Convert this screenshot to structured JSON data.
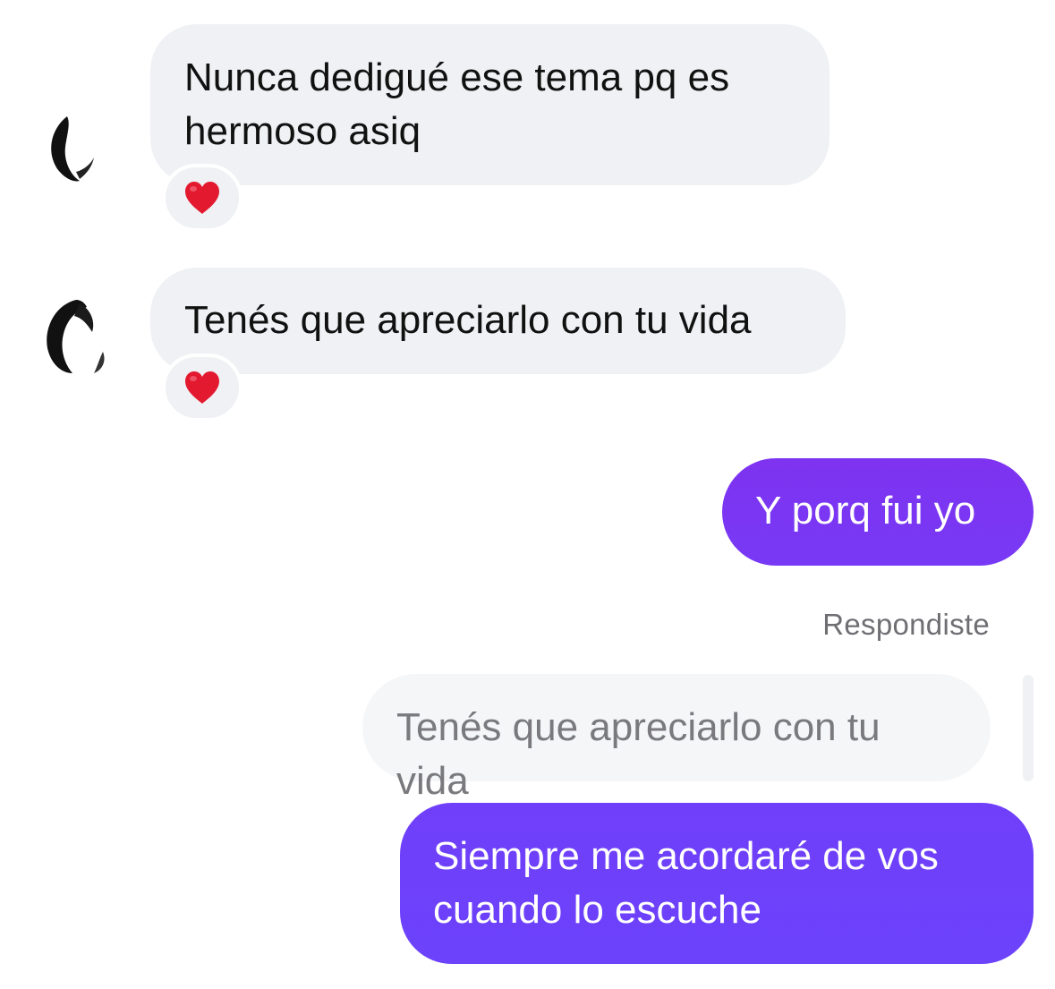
{
  "messages": [
    {
      "direction": "incoming",
      "text_line1": "Nunca dedigué ese tema pq es",
      "text_line2": "hermoso asiq",
      "reaction": "heart-emoji"
    },
    {
      "direction": "incoming",
      "text": "Tenés que apreciarlo con tu vida",
      "reaction": "heart-emoji"
    },
    {
      "direction": "outgoing",
      "text": "Y porq fui yo"
    },
    {
      "direction": "outgoing",
      "reply_label": "Respondiste",
      "quoted_text": "Tenés que apreciarlo con tu vida",
      "text_line1": "Siempre me acordaré de vos",
      "text_line2": "cuando lo escuche"
    }
  ],
  "colors": {
    "incoming_bubble": "#eff1f4",
    "outgoing_gradient_top": "#7d35f2",
    "outgoing_gradient_bottom": "#6b41fb",
    "reaction_heart": "#e3192f"
  }
}
